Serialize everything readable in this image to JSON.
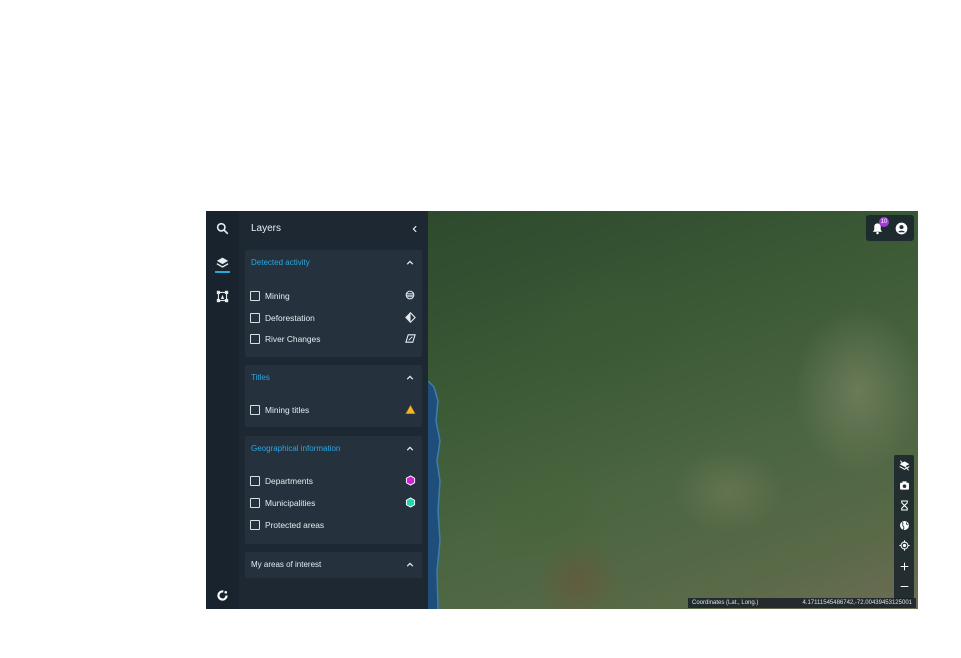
{
  "sidebar": {
    "title": "Layers"
  },
  "groups": [
    {
      "title": "Detected activity",
      "items": [
        {
          "label": "Mining",
          "icon": "striped-circle-icon"
        },
        {
          "label": "Deforestation",
          "icon": "half-diamond-icon"
        },
        {
          "label": "River Changes",
          "icon": "parallelogram-icon"
        }
      ]
    },
    {
      "title": "Titles",
      "items": [
        {
          "label": "Mining titles",
          "icon": "yellow-triangle-icon"
        }
      ]
    },
    {
      "title": "Geographical information",
      "items": [
        {
          "label": "Departments",
          "icon": "magenta-hexagon-icon"
        },
        {
          "label": "Municipalities",
          "icon": "teal-hexagon-icon"
        },
        {
          "label": "Protected areas",
          "icon": ""
        }
      ]
    },
    {
      "title": "My areas of interest",
      "items": []
    }
  ],
  "notifications": {
    "count": "10"
  },
  "coordinates": {
    "label": "Coordinates (Lat., Long.)",
    "value": "4.17111545486742,-72.00439453125001"
  },
  "colors": {
    "accent": "#29a7e1",
    "panel": "#1d2833",
    "badge": "#a13bd6",
    "title_yellow": "#f2b82a",
    "dept_magenta": "#d21fd9",
    "muni_teal": "#1fd6b0"
  }
}
